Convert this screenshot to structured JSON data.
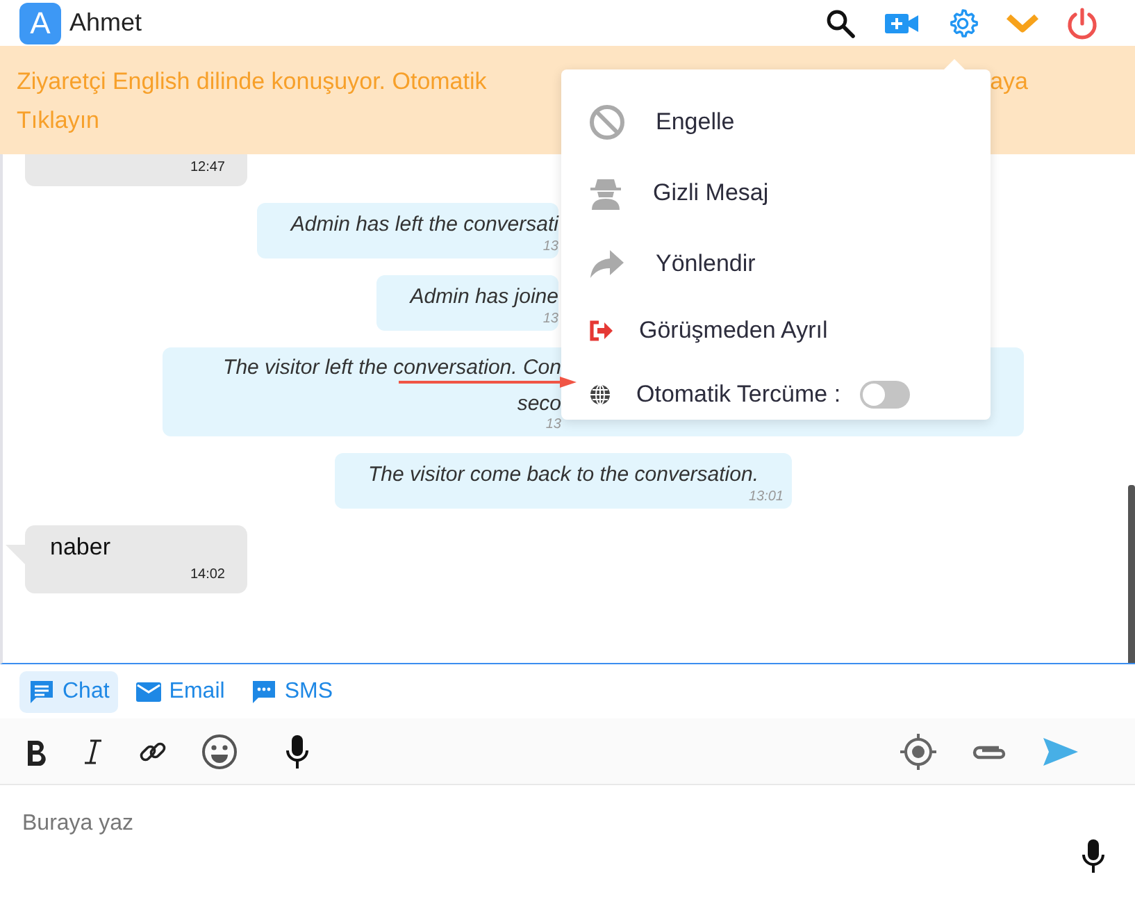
{
  "header": {
    "avatar": "A",
    "name": "Ahmet"
  },
  "banner": {
    "start": "Ziyaretçi English dilinde konuşuyor. Otomatik",
    "end": "aya",
    "line2": "Tıklayın"
  },
  "messages": [
    {
      "kind": "visitor",
      "time": "12:47"
    },
    {
      "kind": "cutnotice",
      "lines": [
        "Admin has left the conversati"
      ],
      "time": "13"
    },
    {
      "kind": "cutnotice",
      "lines": [
        "Admin has joine"
      ],
      "time": "13"
    },
    {
      "kind": "widenotice",
      "lines": [
        "The visitor left the conversation. Con",
        "seco"
      ],
      "time": "13"
    },
    {
      "kind": "notice",
      "lines": [
        "The visitor come back to the conversation."
      ],
      "time": "13:01"
    },
    {
      "kind": "visitor",
      "text": "naber",
      "time": "14:02"
    }
  ],
  "menu": [
    {
      "kind": "action",
      "label": "Engelle"
    },
    {
      "kind": "action",
      "label": "Gizli Mesaj"
    },
    {
      "kind": "action",
      "label": "Yönlendir"
    },
    {
      "kind": "action",
      "label": "Görüşmeden Ayrıl"
    },
    {
      "kind": "toggle",
      "label": "Otomatik Tercüme :",
      "on": false
    }
  ],
  "channels": [
    {
      "label": "Chat",
      "selected": true
    },
    {
      "label": "Email",
      "selected": false
    },
    {
      "label": "SMS",
      "selected": false
    }
  ],
  "composer": {
    "placeholder": "Buraya yaz"
  }
}
